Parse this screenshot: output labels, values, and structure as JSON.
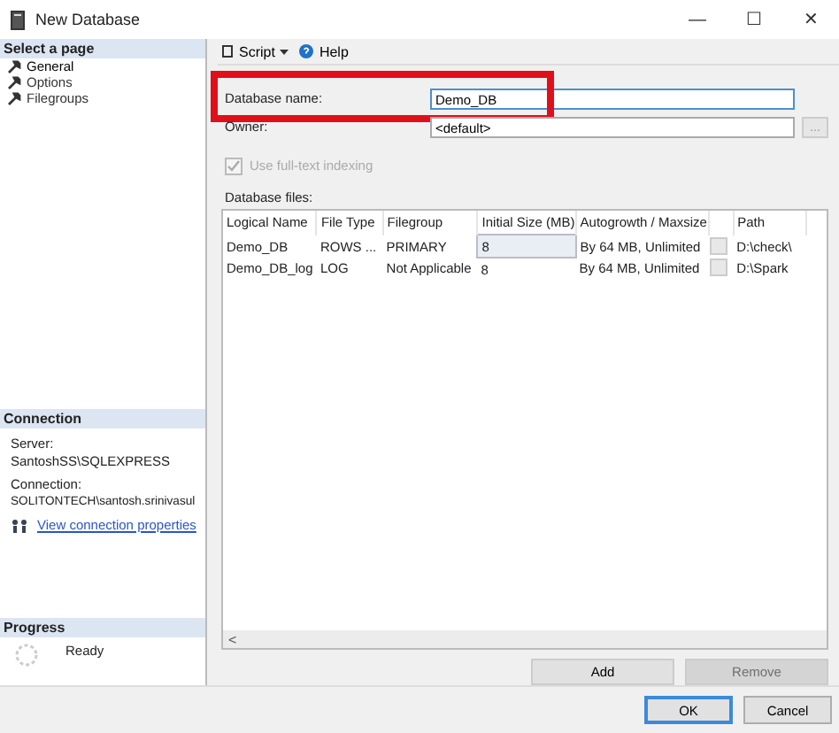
{
  "window": {
    "title": "New Database",
    "controls": [
      "—",
      "☐",
      "✕"
    ]
  },
  "sidebar": {
    "header": "Select a page",
    "items": [
      {
        "label": "General",
        "selected": true
      },
      {
        "label": "Options",
        "selected": false
      },
      {
        "label": "Filegroups",
        "selected": false
      }
    ]
  },
  "connection": {
    "header": "Connection",
    "server_label": "Server:",
    "server": "SantoshSS\\SQLEXPRESS",
    "connection_label": "Connection:",
    "connection": "SOLITONTECH\\santosh.srinivasul",
    "link": "View connection properties"
  },
  "progress": {
    "header": "Progress",
    "status": "Ready"
  },
  "toolbar": {
    "script": "Script",
    "help": "Help"
  },
  "form": {
    "name_label": "Database name:",
    "name_value": "Demo_DB",
    "highlighted": true,
    "owner_label": "Owner:",
    "owner_value": "<default>",
    "owner_button": "...",
    "fulltext": {
      "label": "Use full-text indexing",
      "checked": true,
      "disabled": true
    }
  },
  "table": {
    "label": "Database files:",
    "columns": [
      "Logical Name",
      "File Type",
      "Filegroup",
      "Initial Size (MB)",
      "Autogrowth / Maxsize",
      "Path"
    ],
    "rows": [
      {
        "cells": [
          "Demo_DB",
          "ROWS ...",
          "PRIMARY",
          "8",
          "By 64 MB, Unlimited",
          "D:\\check\\"
        ],
        "selected": true
      },
      {
        "cells": [
          "Demo_DB_log",
          "LOG",
          "Not Applicable",
          "8",
          "By 64 MB, Unlimited",
          "D:\\Spark"
        ],
        "selected": false
      }
    ],
    "scroll_left": "<"
  },
  "table_buttons": [
    {
      "label": "Add",
      "disabled": false
    },
    {
      "label": "Remove",
      "disabled": true
    }
  ],
  "buttons": [
    {
      "label": "OK",
      "default": true
    },
    {
      "label": "Cancel",
      "default": false
    }
  ]
}
